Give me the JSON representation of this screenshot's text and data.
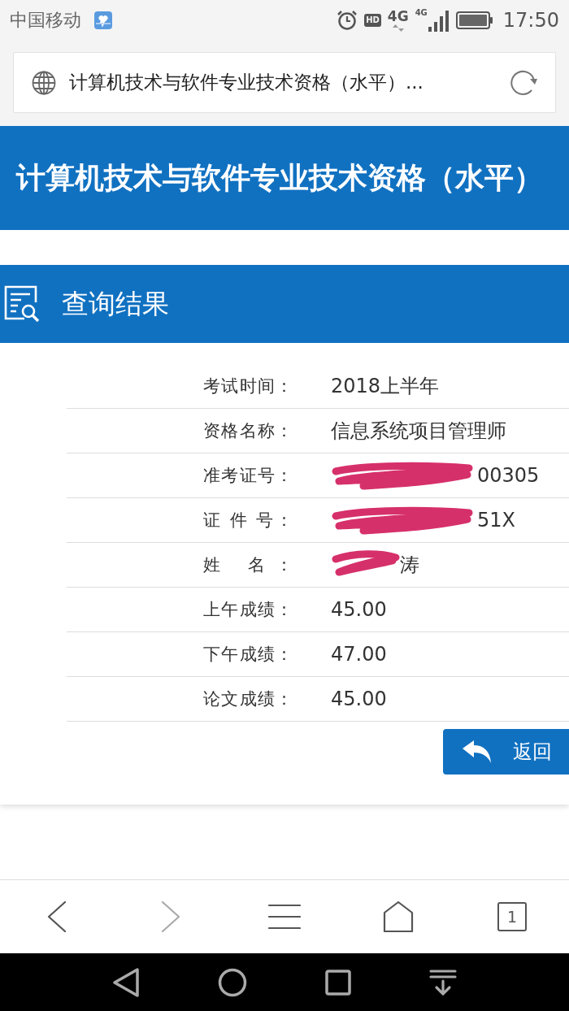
{
  "status_bar": {
    "carrier": "中国移动",
    "indicators": [
      {
        "kind": "hd",
        "label": "HD"
      },
      {
        "kind": "data",
        "label": "4G"
      },
      {
        "kind": "signal",
        "label": "4G"
      }
    ],
    "time": "17:50"
  },
  "address_bar": {
    "title": "计算机技术与软件专业技术资格（水平）..."
  },
  "banner": {
    "title": "计算机技术与软件专业技术资格（水平）"
  },
  "result_card": {
    "heading": "查询结果",
    "rows": [
      {
        "label": "考试时间：",
        "value": "2018上半年",
        "kind": "plain"
      },
      {
        "label": "资格名称：",
        "value": "信息系统项目管理师",
        "kind": "plain"
      },
      {
        "label": "准考证号：",
        "value": "00305",
        "kind": "longmask"
      },
      {
        "label": "证 件 号：",
        "value": "51X",
        "kind": "longmask"
      },
      {
        "label": "姓 名：",
        "value": "涛",
        "kind": "shortmask"
      },
      {
        "label": "上午成绩：",
        "value": "45.00",
        "kind": "plain"
      },
      {
        "label": "下午成绩：",
        "value": "47.00",
        "kind": "plain"
      },
      {
        "label": "论文成绩：",
        "value": "45.00",
        "kind": "plain"
      }
    ],
    "back_button": "返回"
  },
  "browser_toolbar": {
    "items": [
      {
        "kind": "back",
        "disabled": false
      },
      {
        "kind": "forward",
        "disabled": true
      },
      {
        "kind": "menu",
        "disabled": false
      },
      {
        "kind": "home",
        "disabled": false
      },
      {
        "kind": "tabs",
        "count": "1",
        "disabled": false
      }
    ]
  }
}
